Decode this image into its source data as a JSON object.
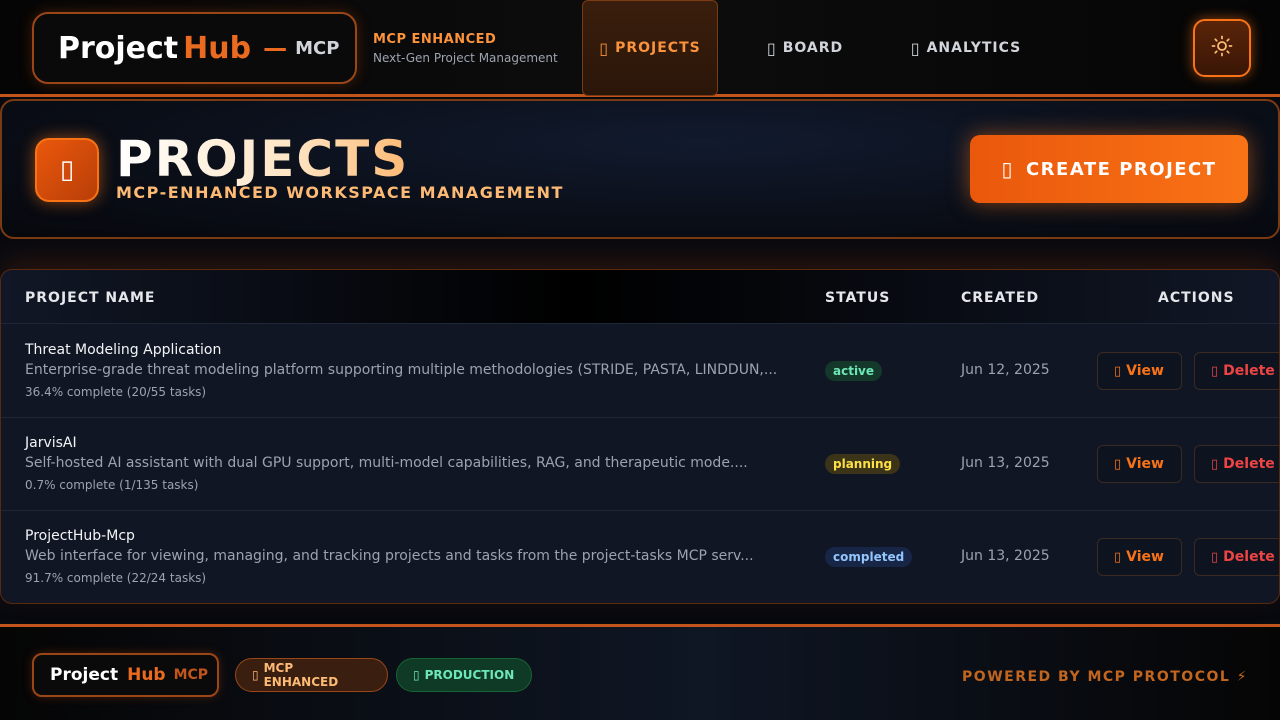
{
  "header": {
    "logo": {
      "project": "Project",
      "hub": "Hub",
      "dash": "—",
      "mcp": "MCP"
    },
    "tagline": {
      "title": "MCP ENHANCED",
      "subtitle": "Next-Gen Project Management"
    },
    "nav": [
      {
        "label": "PROJECTS",
        "icon": "folder-icon",
        "active": true
      },
      {
        "label": "BOARD",
        "icon": "board-icon",
        "active": false
      },
      {
        "label": "ANALYTICS",
        "icon": "chart-icon",
        "active": false
      }
    ],
    "theme_toggle_icon": "sun-icon"
  },
  "page": {
    "title": "PROJECTS",
    "subtitle": "MCP-ENHANCED WORKSPACE MANAGEMENT",
    "create_button": "CREATE PROJECT"
  },
  "table": {
    "columns": [
      "PROJECT NAME",
      "STATUS",
      "CREATED",
      "ACTIONS"
    ],
    "rows": [
      {
        "name": "Threat Modeling Application",
        "description": "Enterprise-grade threat modeling platform supporting multiple methodologies (STRIDE, PASTA, LINDDUN,...",
        "progress": "36.4% complete (20/55 tasks)",
        "status": "active",
        "created": "Jun 12, 2025",
        "view": "View",
        "delete": "Delete"
      },
      {
        "name": "JarvisAI",
        "description": "Self-hosted AI assistant with dual GPU support, multi-model capabilities, RAG, and therapeutic mode....",
        "progress": "0.7% complete (1/135 tasks)",
        "status": "planning",
        "created": "Jun 13, 2025",
        "view": "View",
        "delete": "Delete"
      },
      {
        "name": "ProjectHub-Mcp",
        "description": "Web interface for viewing, managing, and tracking projects and tasks from the project-tasks MCP serv...",
        "progress": "91.7% complete (22/24 tasks)",
        "status": "completed",
        "created": "Jun 13, 2025",
        "view": "View",
        "delete": "Delete"
      }
    ]
  },
  "footer": {
    "logo": {
      "project": "Project",
      "hub": "Hub",
      "mcp": "MCP"
    },
    "badges": [
      "MCP ENHANCED",
      "PRODUCTION"
    ],
    "powered": "POWERED BY MCP PROTOCOL ⚡"
  },
  "colors": {
    "accent": "#f97316",
    "accent_dark": "#c2551b",
    "status_active": "#6ee7b7",
    "status_planning": "#fde047",
    "status_completed": "#93c5fd",
    "danger": "#ef4444"
  }
}
